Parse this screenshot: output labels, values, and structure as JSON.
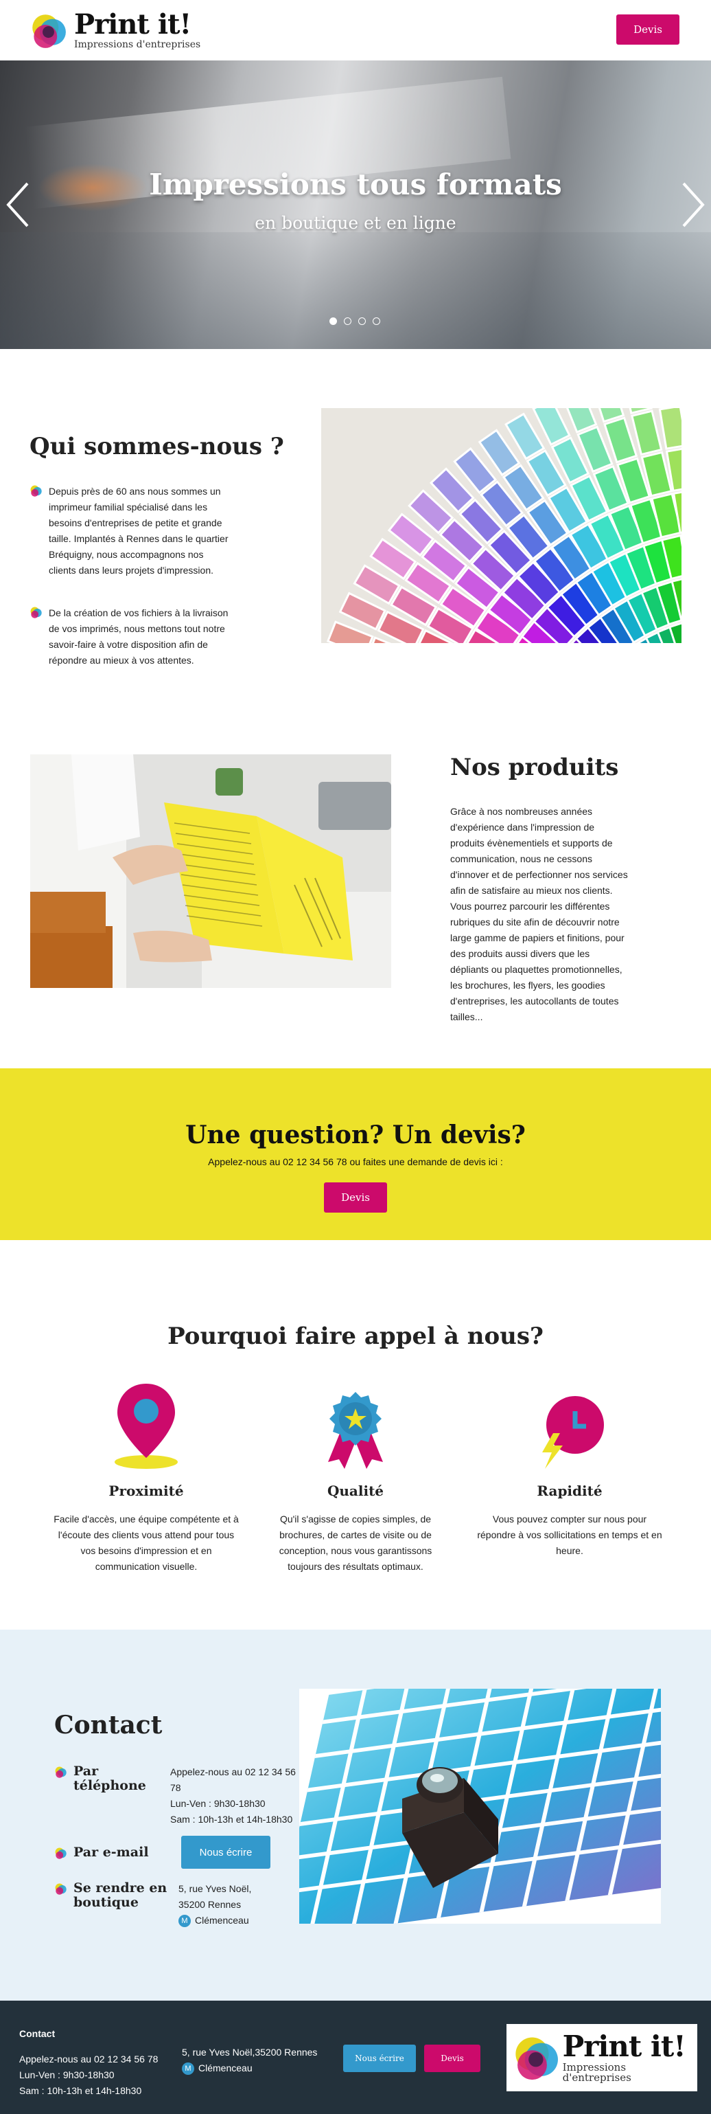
{
  "brand": {
    "name": "Print it!",
    "tagline": "Impressions d'entreprises"
  },
  "header": {
    "cta_label": "Devis"
  },
  "hero": {
    "title": "Impressions tous formats",
    "subtitle": "en boutique et en ligne",
    "slides": 4,
    "active_slide": 1
  },
  "about": {
    "title": "Qui sommes-nous ?",
    "paragraphs": [
      "Depuis près de 60 ans nous sommes un imprimeur familial spécialisé dans les besoins d'entreprises de petite et grande taille. Implantés à Rennes dans le quartier Bréquigny, nous accompagnons nos clients dans leurs projets d'impression.",
      "De la création de vos fichiers à la livraison de vos imprimés, nous mettons tout notre savoir-faire à votre disposition afin de répondre au mieux à vos attentes."
    ]
  },
  "products": {
    "title": "Nos produits",
    "text": "Grâce à nos nombreuses années d'expérience dans l'impression de produits évènementiels et supports de communication, nous ne cessons d'innover et de perfectionner nos services afin de satisfaire au mieux nos clients. Vous pourrez parcourir les différentes rubriques du site afin de découvrir notre large gamme de papiers et finitions, pour des produits aussi divers que les dépliants ou plaquettes promotionnelles, les brochures, les flyers, les goodies d'entreprises, les autocollants de toutes tailles..."
  },
  "cta": {
    "title": "Une question? Un devis?",
    "text": "Appelez-nous au 02 12 34 56 78 ou faites une demande de devis ici :",
    "button": "Devis"
  },
  "why": {
    "title": "Pourquoi faire appel à nous?",
    "items": [
      {
        "title": "Proximité",
        "text": "Facile d'accès, une équipe compétente et à l'écoute des clients vous attend pour tous vos besoins d'impression et en communication visuelle."
      },
      {
        "title": "Qualité",
        "text": "Qu'il s'agisse de copies simples, de brochures, de cartes de visite ou de conception, nous vous garantissons toujours des résultats optimaux."
      },
      {
        "title": "Rapidité",
        "text": "Vous pouvez compter sur nous pour répondre à vos sollicitations en temps et en heure."
      }
    ]
  },
  "contact": {
    "title": "Contact",
    "phone": {
      "label": "Par téléphone",
      "line1": "Appelez-nous au 02 12 34 56 78",
      "line2": "Lun-Ven : 9h30-18h30",
      "line3": "Sam : 10h-13h et 14h-18h30"
    },
    "email": {
      "label": "Par e-mail",
      "button": "Nous écrire"
    },
    "visit": {
      "label": "Se rendre en boutique",
      "street": "5, rue Yves Noël,",
      "city": "35200 Rennes",
      "metro_badge": "M",
      "metro": "Clémenceau"
    }
  },
  "footer": {
    "title": "Contact",
    "phone": "Appelez-nous au 02 12 34 56 78",
    "hours1": "Lun-Ven : 9h30-18h30",
    "hours2": "Sam : 10h-13h et 14h-18h30",
    "address": "5, rue Yves Noël,35200 Rennes",
    "metro_badge": "M",
    "metro": "Clémenceau",
    "write_button": "Nous écrire",
    "quote_button": "Devis"
  },
  "colors": {
    "magenta": "#cc0a6b",
    "blue": "#3399cc",
    "yellow": "#ede22a",
    "footer": "#23313b",
    "contact_bg": "#e7f1f8"
  },
  "icons": {
    "logo": "cmy-circles-icon",
    "bullet": "cmy-bullet-icon",
    "proximity": "map-pin-icon",
    "quality": "award-ribbon-icon",
    "speed": "clock-lightning-icon",
    "prev": "chevron-left-icon",
    "next": "chevron-right-icon"
  }
}
